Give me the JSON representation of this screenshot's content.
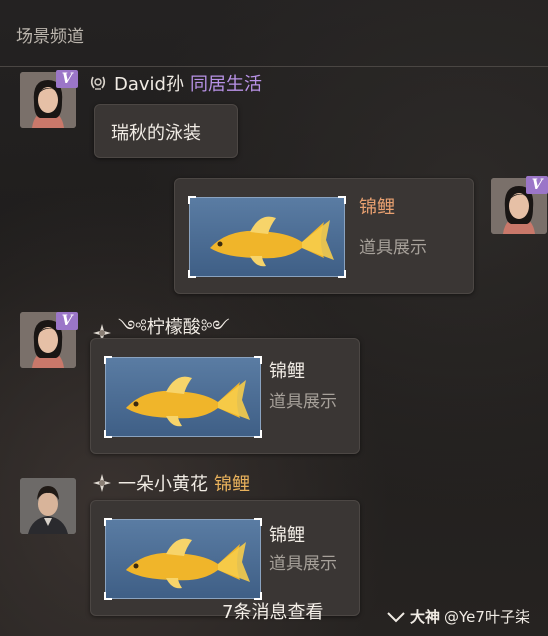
{
  "header": {
    "title": "场景频道"
  },
  "messages": [
    {
      "sender": "David孙",
      "tag": "同居生活",
      "text": "瑞秋的泳装"
    },
    {
      "item": {
        "name": "锦鲤",
        "subtitle": "道具展示"
      }
    },
    {
      "sender": "༺柠檬酸༻",
      "item": {
        "name": "锦鲤",
        "subtitle": "道具展示"
      }
    },
    {
      "sender": "一朵小黄花",
      "tag": "锦鲤",
      "item": {
        "name": "锦鲤",
        "subtitle": "道具展示"
      }
    }
  ],
  "vip_label": "V",
  "footer": {
    "unread": "7条消息查看"
  },
  "watermark": {
    "brand": "大神",
    "handle": "@Ye7叶子柒"
  },
  "colors": {
    "item_name_self": "#e8a070",
    "item_name_other": "#f0ebe4",
    "tag_purple": "#b892e6",
    "tag_gold": "#e8b15c"
  },
  "icons": [
    "laurel-badge-icon",
    "sparkle-badge-icon",
    "goldfish-icon",
    "vip-badge-icon",
    "chevron-down-icon"
  ]
}
